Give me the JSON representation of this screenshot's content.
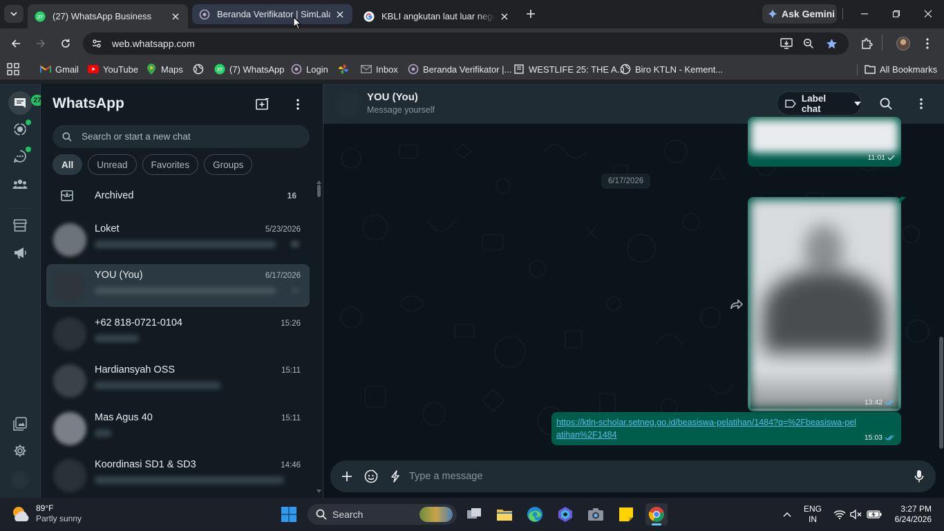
{
  "browser": {
    "tabs": [
      {
        "title": "(27) WhatsApp Business",
        "state": "active"
      },
      {
        "title": "Beranda Verifikator | SimLala",
        "state": "hover"
      },
      {
        "title": "KBLI angkutan laut luar negeri u",
        "state": "normal"
      }
    ],
    "ask_gemini": "Ask Gemini",
    "url": "web.whatsapp.com",
    "bookmarks": [
      {
        "label": "Gmail",
        "icon": "gmail-icon"
      },
      {
        "label": "YouTube",
        "icon": "youtube-icon"
      },
      {
        "label": "Maps",
        "icon": "maps-icon"
      },
      {
        "label": "",
        "icon": "globe-icon"
      },
      {
        "label": "(7) WhatsApp",
        "icon": "whatsapp-icon",
        "badge": "27"
      },
      {
        "label": "Login",
        "icon": "simlala-icon"
      },
      {
        "label": "",
        "icon": "pinwheel-icon"
      },
      {
        "label": "Inbox",
        "icon": "mail-icon"
      },
      {
        "label": "Beranda Verifikator |...",
        "icon": "simlala-icon"
      },
      {
        "label": "WESTLIFE 25: THE A...",
        "icon": "page-icon"
      },
      {
        "label": "Biro KTLN - Kement...",
        "icon": "globe-icon"
      }
    ],
    "all_bookmarks": "All Bookmarks"
  },
  "whatsapp": {
    "rail_badge": "27",
    "title": "WhatsApp",
    "search_placeholder": "Search or start a new chat",
    "filters": [
      "All",
      "Unread",
      "Favorites",
      "Groups"
    ],
    "active_filter": "All",
    "archived": {
      "label": "Archived",
      "count": "16"
    },
    "chats": [
      {
        "name": "Loket",
        "time": "5/23/2026"
      },
      {
        "name": "YOU (You)",
        "time": "6/17/2026",
        "selected": true
      },
      {
        "name": "+62 818-0721-0104",
        "time": "15:26"
      },
      {
        "name": "Hardiansyah OSS",
        "time": "15:11"
      },
      {
        "name": "Mas Agus 40",
        "time": "15:11"
      },
      {
        "name": "Koordinasi SD1 & SD3",
        "time": "14:46"
      }
    ],
    "conversation": {
      "name": "YOU (You)",
      "subtitle": "Message yourself",
      "label_chat": "Label chat",
      "messages": [
        {
          "type": "image",
          "time": "11:01",
          "status": "sent"
        },
        {
          "type": "date",
          "text": "6/17/2026"
        },
        {
          "type": "image",
          "time": "13:42",
          "status": "read"
        },
        {
          "type": "link",
          "text": "https://ktln-scholar.setneg.go.id/beasiswa-pelatihan/1484?q=%2Fbeasiswa-pelatihan%2F1484",
          "time": "15:03",
          "status": "read"
        }
      ],
      "composer_placeholder": "Type a message"
    }
  },
  "taskbar": {
    "weather_temp": "89°F",
    "weather_desc": "Partly sunny",
    "search_placeholder": "Search",
    "lang_top": "ENG",
    "lang_bottom": "IN",
    "time": "3:27 PM",
    "date": "6/24/2026"
  },
  "colors": {
    "wa_accent": "#21c063",
    "bubble_out": "#005c4b",
    "link": "#53bdeb",
    "read_tick": "#53bdeb"
  }
}
